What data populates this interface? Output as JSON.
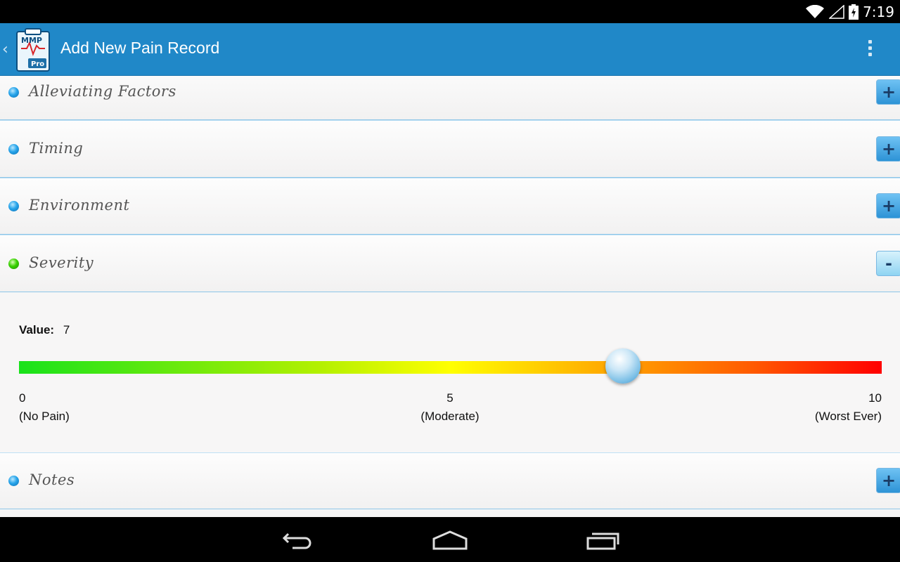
{
  "status_bar": {
    "time": "7:19",
    "icons": [
      "wifi-icon",
      "signal-icon",
      "battery-icon"
    ]
  },
  "action_bar": {
    "title": "Add New Pain Record",
    "logo_text": "MMP",
    "logo_badge": "Pro",
    "icons": [
      "back-caret-icon",
      "app-logo-icon",
      "overflow-menu-icon"
    ]
  },
  "sections": [
    {
      "label": "Alleviating Factors",
      "state": "collapsed",
      "toggle": "+"
    },
    {
      "label": "Timing",
      "state": "collapsed",
      "toggle": "+"
    },
    {
      "label": "Environment",
      "state": "collapsed",
      "toggle": "+"
    },
    {
      "label": "Severity",
      "state": "expanded",
      "toggle": "-"
    },
    {
      "label": "Notes",
      "state": "collapsed",
      "toggle": "+"
    }
  ],
  "severity": {
    "value_label": "Value:",
    "value": "7",
    "min": 0,
    "max": 10,
    "current": 7,
    "ticks": [
      {
        "value": "0",
        "desc": "(No Pain)"
      },
      {
        "value": "5",
        "desc": "(Moderate)"
      },
      {
        "value": "10",
        "desc": "(Worst Ever)"
      }
    ]
  },
  "colors": {
    "action_bar": "#2088c8",
    "accent": "#2d93d6",
    "collapsed_dot": "#27a4ea",
    "expanded_dot": "#38d100"
  },
  "nav_bar": {
    "icons": [
      "back-icon",
      "home-icon",
      "recents-icon"
    ]
  }
}
